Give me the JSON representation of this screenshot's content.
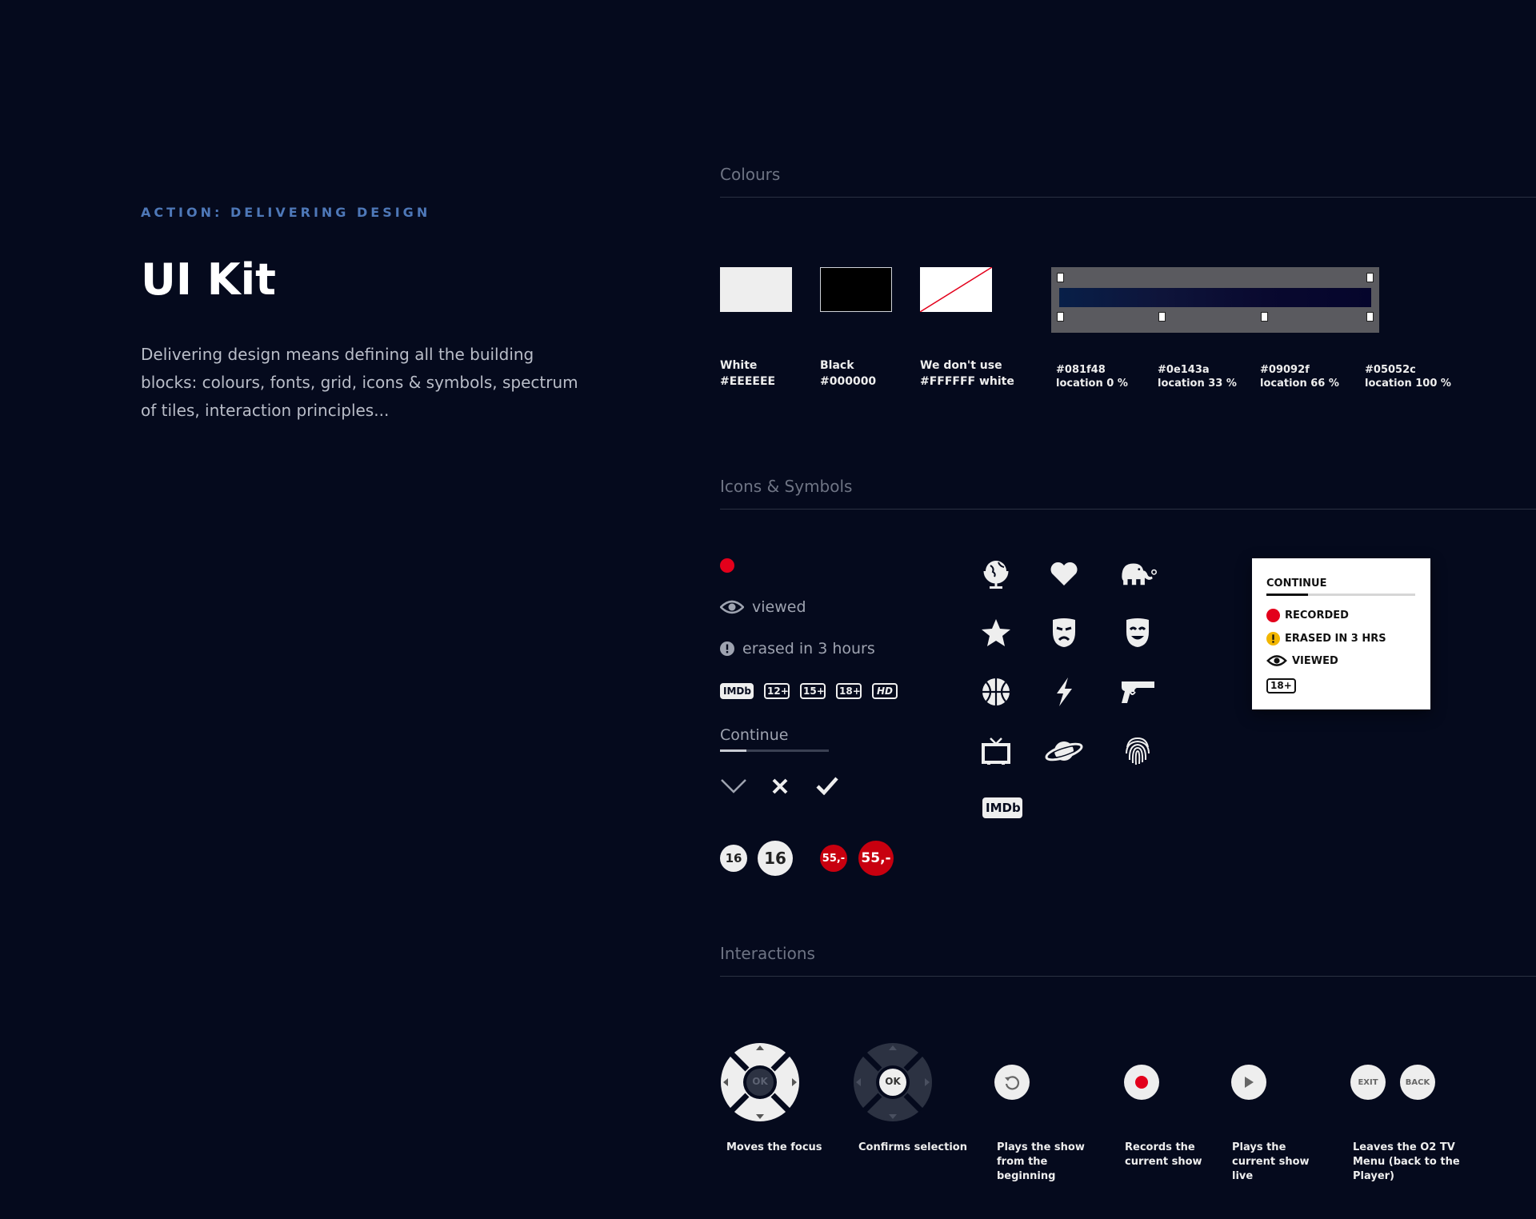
{
  "header": {
    "eyebrow": "ACTION: DELIVERING DESIGN",
    "title": "UI Kit",
    "intro": "Delivering design means defining all the building blocks: colours, fonts, grid, icons & symbols, spectrum of tiles, interaction principles..."
  },
  "colours": {
    "title": "Colours",
    "swatches": [
      {
        "name": "White",
        "value": "#EEEEEE"
      },
      {
        "name": "Black",
        "value": "#000000"
      },
      {
        "name": "We don't use",
        "value": "#FFFFFF white"
      }
    ],
    "gradient_stops": [
      {
        "color": "#081f48",
        "location": "location 0 %"
      },
      {
        "color": "#0e143a",
        "location": "location 33 %"
      },
      {
        "color": "#09092f",
        "location": "location 66 %"
      },
      {
        "color": "#05052c",
        "location": "location 100 %"
      }
    ]
  },
  "icons": {
    "title": "Icons & Symbols",
    "viewed": "viewed",
    "erased": "erased in 3 hours",
    "badges": [
      "IMDb",
      "12+",
      "15+",
      "18+",
      "HD"
    ],
    "continue": "Continue",
    "continue_progress": 0.24,
    "numbers": [
      "16",
      "16",
      "55,-",
      "55,-"
    ],
    "genre_icons": [
      "globe-icon",
      "heart-icon",
      "elephant-icon",
      "star-icon",
      "tragedy-mask-icon",
      "comedy-mask-icon",
      "basketball-icon",
      "lightning-icon",
      "gun-icon",
      "tv-icon",
      "planet-icon",
      "fingerprint-icon",
      "imdb-icon"
    ],
    "imdb_label": "IMDb",
    "legend": {
      "title": "CONTINUE",
      "progress": 0.28,
      "recorded": "RECORDED",
      "erased": "ERASED IN 3 HRS",
      "viewed": "VIEWED",
      "age": "18+",
      "colors": {
        "recorded": "#e3001b",
        "erased": "#f2b600"
      }
    }
  },
  "interactions": {
    "title": "Interactions",
    "ok": "OK",
    "exit": "EXIT",
    "back": "BACK",
    "items": [
      {
        "label": "Moves the focus"
      },
      {
        "label": "Confirms selection"
      },
      {
        "label": "Plays the show from the beginning"
      },
      {
        "label": "Records the current show"
      },
      {
        "label": "Plays the current show live"
      },
      {
        "label": "Leaves the O2 TV Menu (back to the Player)"
      }
    ]
  },
  "accent_colors": {
    "background": "#050a1d",
    "eyebrow": "#4e78b8",
    "record": "#e3001b",
    "price": "#c8000f"
  }
}
